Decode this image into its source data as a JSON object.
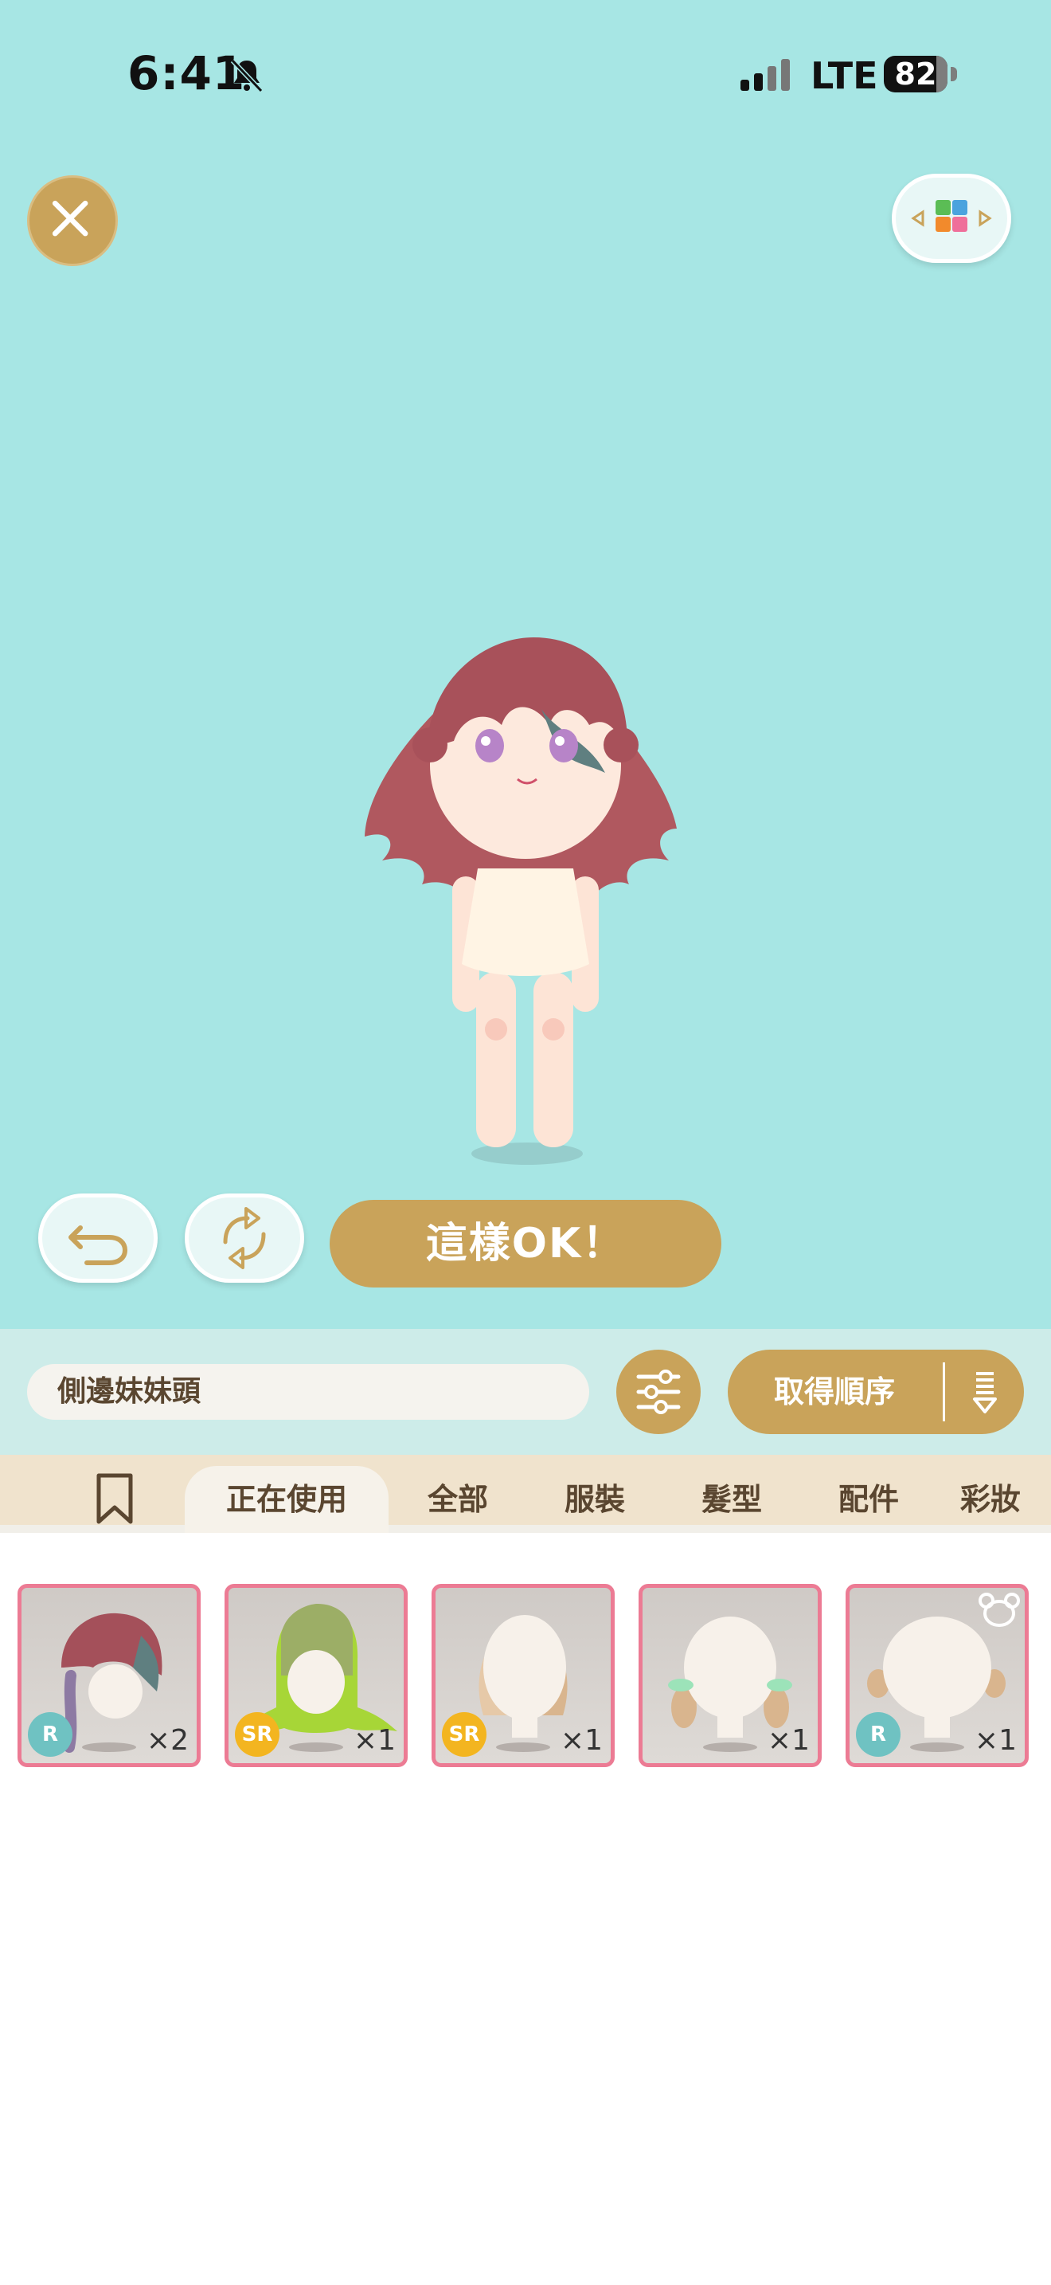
{
  "status_bar": {
    "time": "6:41",
    "network": "LTE",
    "battery": "82"
  },
  "icons": {
    "close": "close-icon",
    "grid": "color-grid-icon",
    "undo": "undo-icon",
    "rotate": "rotate-icon",
    "filter": "sliders-icon",
    "sort": "sort-list-icon",
    "bookmark": "bookmark-icon"
  },
  "actions": {
    "confirm_label": "這樣OK！"
  },
  "search": {
    "value": "側邊妹妹頭"
  },
  "sort": {
    "label": "取得順序"
  },
  "tabs": [
    {
      "label": "正在使用",
      "active": true
    },
    {
      "label": "全部"
    },
    {
      "label": "服裝"
    },
    {
      "label": "髮型"
    },
    {
      "label": "配件"
    },
    {
      "label": "彩妝"
    }
  ],
  "items": [
    {
      "rarity": "R",
      "count": "×2"
    },
    {
      "rarity": "SR",
      "count": "×1"
    },
    {
      "rarity": "SR",
      "count": "×1"
    },
    {
      "rarity": "",
      "count": "×1"
    },
    {
      "rarity": "R",
      "count": "×1"
    }
  ],
  "colors": {
    "stage_bg": "#a7e6e4",
    "accent_gold": "#c9a35a",
    "card_border": "#ec7b94",
    "tab_bar": "#f0e3cd"
  }
}
